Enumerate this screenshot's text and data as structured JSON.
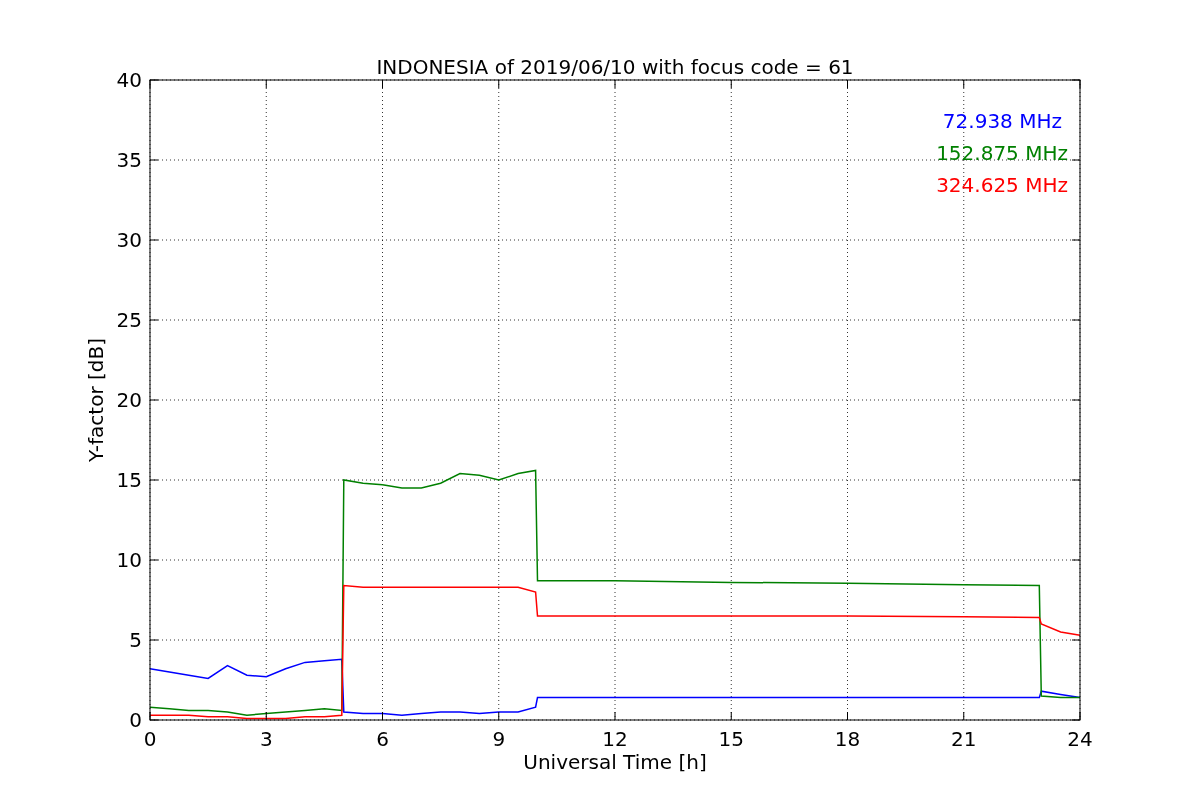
{
  "chart_data": {
    "type": "line",
    "title": "INDONESIA of 2019/06/10 with focus code = 61",
    "xlabel": "Universal Time [h]",
    "ylabel": "Y-factor [dB]",
    "x": [
      0,
      0.5,
      1,
      1.5,
      2,
      2.5,
      3,
      3.5,
      4,
      4.5,
      4.95,
      5,
      5.5,
      6,
      6.5,
      7,
      7.5,
      8,
      8.5,
      9,
      9.5,
      9.95,
      10,
      12,
      15,
      18,
      21,
      22.95,
      23,
      23.5,
      24
    ],
    "series": [
      {
        "name": "72.938 MHz",
        "color": "#0000ff",
        "values": [
          3.2,
          3,
          2.8,
          2.6,
          3.4,
          2.8,
          2.7,
          3.2,
          3.6,
          3.7,
          3.8,
          0.5,
          0.4,
          0.4,
          0.3,
          0.4,
          0.5,
          0.5,
          0.4,
          0.5,
          0.5,
          0.8,
          1.4,
          1.4,
          1.4,
          1.4,
          1.4,
          1.4,
          1.8,
          1.6,
          1.4
        ]
      },
      {
        "name": "152.875 MHz",
        "color": "#008000",
        "values": [
          0.8,
          0.7,
          0.6,
          0.6,
          0.5,
          0.3,
          0.4,
          0.5,
          0.6,
          0.7,
          0.6,
          15,
          14.8,
          14.7,
          14.5,
          14.5,
          14.8,
          15.4,
          15.3,
          15,
          15.4,
          15.6,
          8.7,
          8.7,
          8.6,
          8.55,
          8.45,
          8.4,
          1.5,
          1.4,
          1.4
        ]
      },
      {
        "name": "324.625 MHz",
        "color": "#ff0000",
        "values": [
          0.3,
          0.3,
          0.3,
          0.2,
          0.2,
          0.1,
          0.1,
          0.1,
          0.2,
          0.2,
          0.3,
          8.4,
          8.3,
          8.3,
          8.3,
          8.3,
          8.3,
          8.3,
          8.3,
          8.3,
          8.3,
          8,
          6.5,
          6.5,
          6.5,
          6.5,
          6.45,
          6.4,
          6,
          5.5,
          5.3
        ]
      }
    ],
    "grid": true,
    "xlim": [
      0,
      24
    ],
    "ylim": [
      0,
      40
    ],
    "xticks": [
      0,
      3,
      6,
      9,
      12,
      15,
      18,
      21,
      24
    ],
    "yticks": [
      0,
      5,
      10,
      15,
      20,
      25,
      30,
      35,
      40
    ]
  }
}
